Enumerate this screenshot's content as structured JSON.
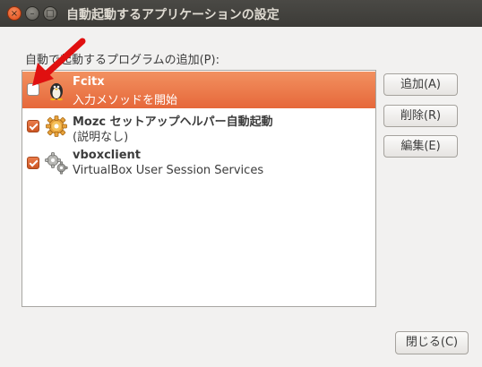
{
  "window": {
    "title": "自動起動するアプリケーションの設定",
    "controls": {
      "close": "×",
      "minimize": "–",
      "maximize": "□"
    }
  },
  "list": {
    "label": "自動で起動するプログラムの追加(P):",
    "items": [
      {
        "name": "Fcitx",
        "description": "入力メソッドを開始",
        "checked": false,
        "selected": true,
        "icon": "penguin-icon"
      },
      {
        "name": "Mozc セットアップヘルパー自動起動",
        "description": "(説明なし)",
        "checked": true,
        "selected": false,
        "icon": "gear-icon"
      },
      {
        "name": "vboxclient",
        "description": "VirtualBox User Session Services",
        "checked": true,
        "selected": false,
        "icon": "gears-icon"
      }
    ]
  },
  "buttons": {
    "add": "追加(A)",
    "remove": "削除(R)",
    "edit": "編集(E)",
    "close": "閉じる(C)"
  },
  "colors": {
    "selection": "#e9744a",
    "annotation_arrow": "#e01010",
    "titlebar": "#3c3b37"
  }
}
